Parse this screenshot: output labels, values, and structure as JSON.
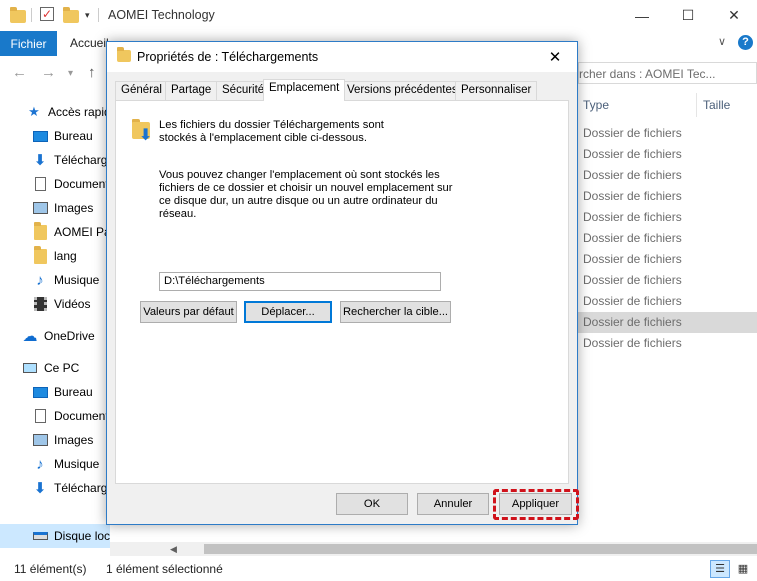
{
  "explorer": {
    "window_title": "AOMEI Technology",
    "ribbon": {
      "file_tab": "Fichier",
      "home_tab": "Accueil"
    },
    "search_placeholder": "rcher dans : AOMEI Tec...",
    "columns": [
      "Type",
      "Taille"
    ],
    "nav_items": [
      {
        "label": "Accès rapide",
        "icon": "star-icon"
      },
      {
        "label": "Bureau",
        "icon": "desktop-icon"
      },
      {
        "label": "Téléchargements",
        "icon": "download-icon"
      },
      {
        "label": "Documents",
        "icon": "document-icon"
      },
      {
        "label": "Images",
        "icon": "image-icon"
      },
      {
        "label": "AOMEI Partition",
        "icon": "folder-icon"
      },
      {
        "label": "lang",
        "icon": "folder-icon"
      },
      {
        "label": "Musique",
        "icon": "music-icon"
      },
      {
        "label": "Vidéos",
        "icon": "video-icon"
      },
      {
        "label": "OneDrive",
        "icon": "cloud-icon"
      },
      {
        "label": "Ce PC",
        "icon": "computer-icon"
      },
      {
        "label": "Bureau",
        "icon": "desktop-icon"
      },
      {
        "label": "Documents",
        "icon": "document-icon"
      },
      {
        "label": "Images",
        "icon": "image-icon"
      },
      {
        "label": "Musique",
        "icon": "music-icon"
      },
      {
        "label": "Téléchargements",
        "icon": "download-icon"
      },
      {
        "label": "Disque local (C:)",
        "icon": "drive-icon"
      }
    ],
    "file_types": [
      "Dossier de fichiers",
      "Dossier de fichiers",
      "Dossier de fichiers",
      "Dossier de fichiers",
      "Dossier de fichiers",
      "Dossier de fichiers",
      "Dossier de fichiers",
      "Dossier de fichiers",
      "Dossier de fichiers",
      "Dossier de fichiers",
      "Dossier de fichiers"
    ],
    "status": {
      "count": "11 élément(s)",
      "selected": "1 élément sélectionné"
    }
  },
  "dialog": {
    "title": "Propriétés de : Téléchargements",
    "tabs": [
      "Général",
      "Partage",
      "Sécurité",
      "Emplacement",
      "Versions précédentes",
      "Personnaliser"
    ],
    "active_tab": "Emplacement",
    "info_line1": "Les fichiers du dossier Téléchargements sont",
    "info_line2": "stockés à l'emplacement cible ci-dessous.",
    "desc_lines": [
      "Vous pouvez changer l'emplacement où sont stockés les",
      "fichiers de ce dossier et choisir un nouvel emplacement sur",
      "ce disque dur, un autre disque ou un autre ordinateur du",
      "réseau."
    ],
    "path_value": "D:\\Téléchargements",
    "buttons": {
      "restore_default": "Valeurs par défaut",
      "move": "Déplacer...",
      "find_target": "Rechercher la cible...",
      "ok": "OK",
      "cancel": "Annuler",
      "apply": "Appliquer"
    },
    "highlight_color": "#d0121b"
  }
}
